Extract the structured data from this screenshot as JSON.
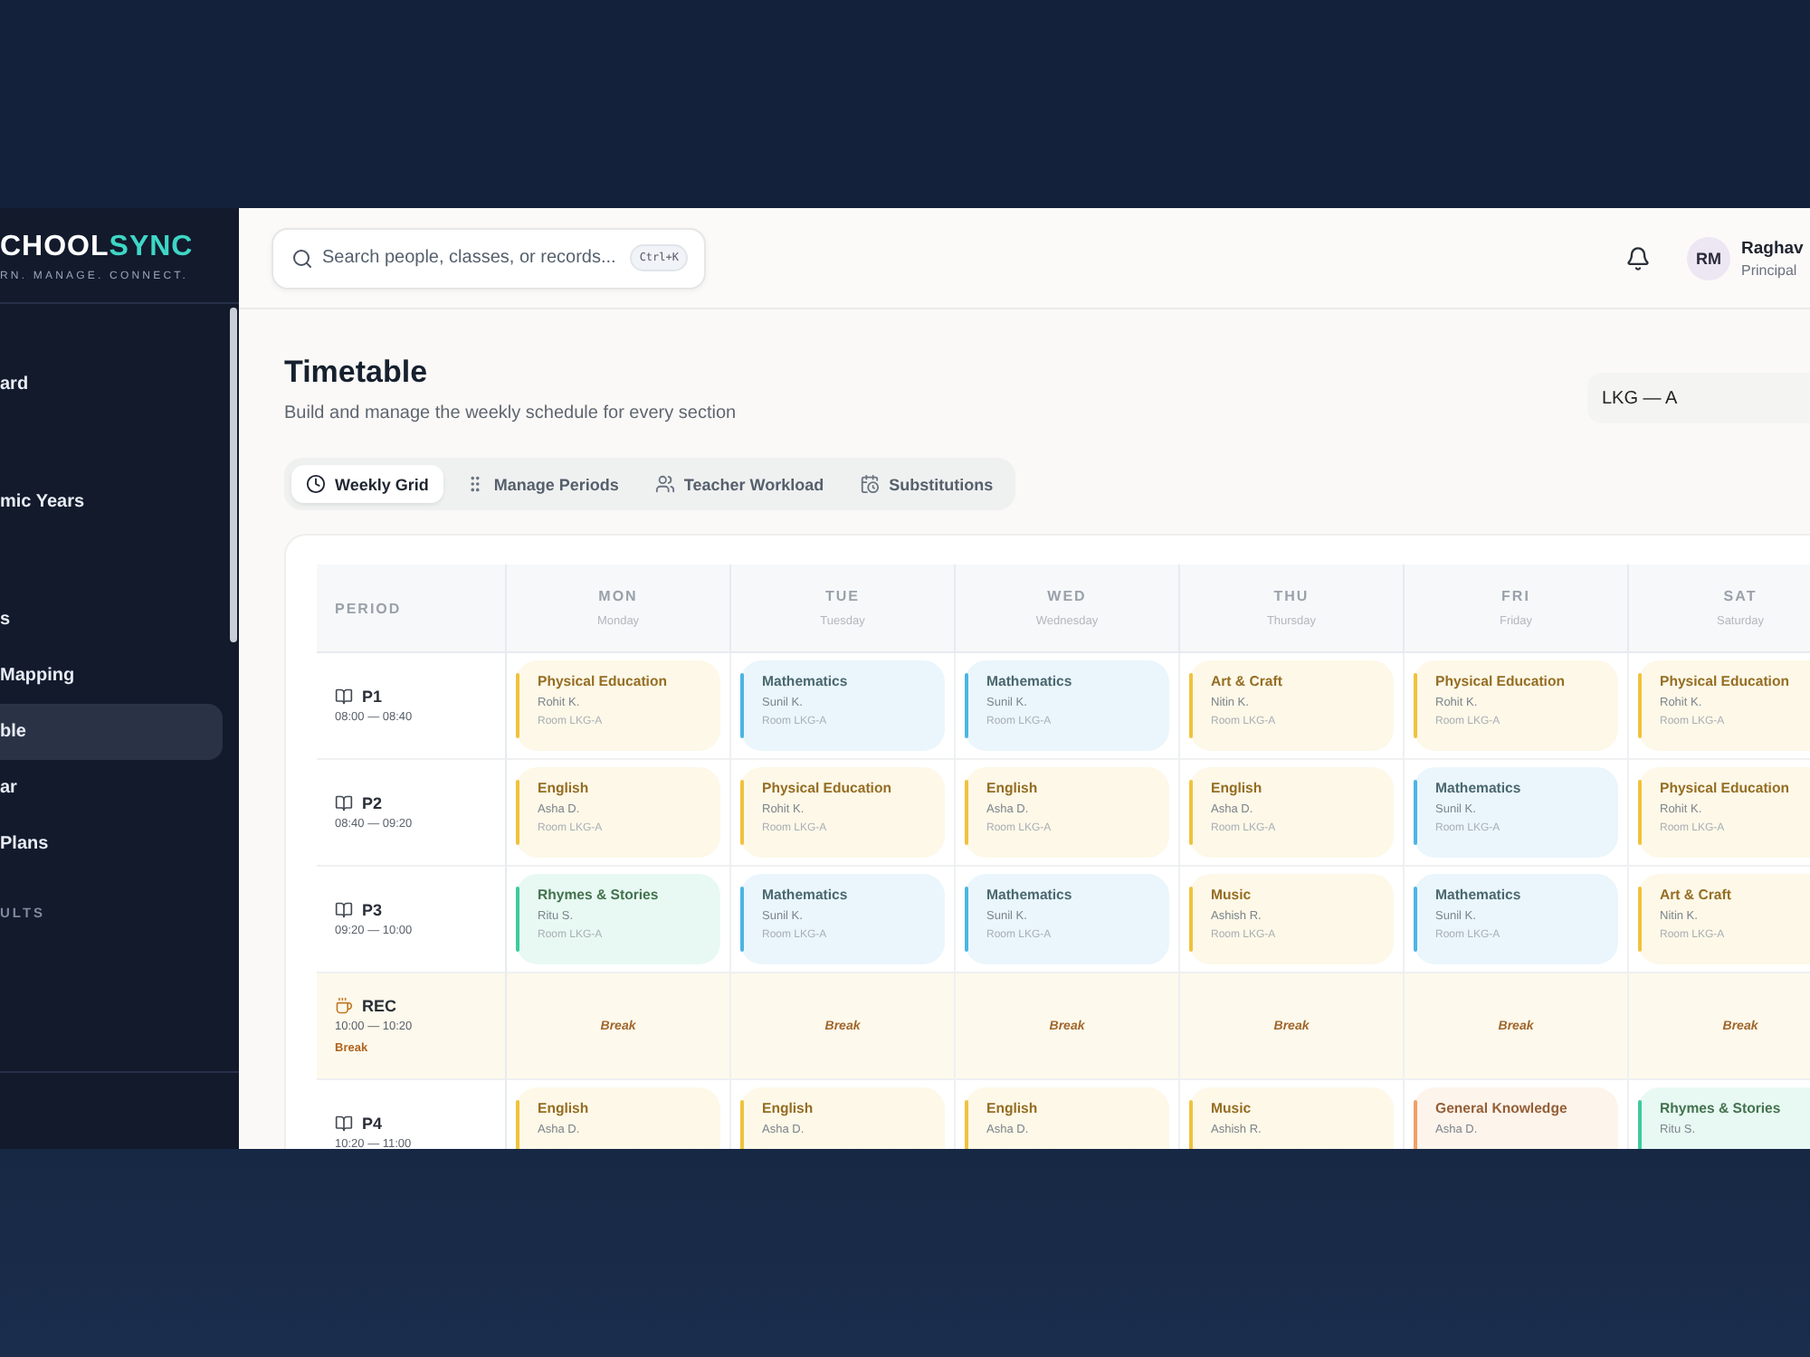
{
  "brand": {
    "name_a": "CHOOL",
    "name_b": "SYNC",
    "tagline": "RN. MANAGE. CONNECT."
  },
  "sidebar": {
    "items": [
      {
        "label": "ard",
        "selected": false
      },
      {
        "label": "mic Years",
        "selected": false
      },
      {
        "label": "s",
        "selected": false
      },
      {
        "label": "Mapping",
        "selected": false
      },
      {
        "label": "ble",
        "selected": true
      },
      {
        "label": "ar",
        "selected": false
      },
      {
        "label": "Plans",
        "selected": false
      }
    ],
    "section": "ULTS"
  },
  "search": {
    "placeholder": "Search people, classes, or records...",
    "shortcut": "Ctrl+K"
  },
  "user": {
    "initials": "RM",
    "name": "Raghav",
    "role": "Principal"
  },
  "page": {
    "title": "Timetable",
    "subtitle": "Build and manage the weekly schedule for every section",
    "section_select": "LKG — A"
  },
  "tabs": [
    {
      "label": "Weekly Grid",
      "selected": true
    },
    {
      "label": "Manage Periods",
      "selected": false
    },
    {
      "label": "Teacher Workload",
      "selected": false
    },
    {
      "label": "Substitutions",
      "selected": false
    }
  ],
  "table": {
    "period_heading": "PERIOD",
    "days": [
      {
        "short": "MON",
        "long": "Monday"
      },
      {
        "short": "TUE",
        "long": "Tuesday"
      },
      {
        "short": "WED",
        "long": "Wednesday"
      },
      {
        "short": "THU",
        "long": "Thursday"
      },
      {
        "short": "FRI",
        "long": "Friday"
      },
      {
        "short": "SAT",
        "long": "Saturday"
      }
    ],
    "rows": [
      {
        "kind": "class",
        "period": "P1",
        "time": "08:00 — 08:40",
        "cells": [
          {
            "subject": "Physical Education",
            "teacher": "Rohit K.",
            "room": "Room LKG-A",
            "color": "#f0c23c"
          },
          {
            "subject": "Mathematics",
            "teacher": "Sunil K.",
            "room": "Room LKG-A",
            "color": "#4cb4e4"
          },
          {
            "subject": "Mathematics",
            "teacher": "Sunil K.",
            "room": "Room LKG-A",
            "color": "#4cb4e4"
          },
          {
            "subject": "Art & Craft",
            "teacher": "Nitin K.",
            "room": "Room LKG-A",
            "color": "#f0c23c"
          },
          {
            "subject": "Physical Education",
            "teacher": "Rohit K.",
            "room": "Room LKG-A",
            "color": "#f0c23c"
          },
          {
            "subject": "Physical Education",
            "teacher": "Rohit K.",
            "room": "Room LKG-A",
            "color": "#f0c23c"
          }
        ]
      },
      {
        "kind": "class",
        "period": "P2",
        "time": "08:40 — 09:20",
        "cells": [
          {
            "subject": "English",
            "teacher": "Asha D.",
            "room": "Room LKG-A",
            "color": "#f0c23c"
          },
          {
            "subject": "Physical Education",
            "teacher": "Rohit K.",
            "room": "Room LKG-A",
            "color": "#f0c23c"
          },
          {
            "subject": "English",
            "teacher": "Asha D.",
            "room": "Room LKG-A",
            "color": "#f0c23c"
          },
          {
            "subject": "English",
            "teacher": "Asha D.",
            "room": "Room LKG-A",
            "color": "#f0c23c"
          },
          {
            "subject": "Mathematics",
            "teacher": "Sunil K.",
            "room": "Room LKG-A",
            "color": "#4cb4e4"
          },
          {
            "subject": "Physical Education",
            "teacher": "Rohit K.",
            "room": "Room LKG-A",
            "color": "#f0c23c"
          }
        ]
      },
      {
        "kind": "class",
        "period": "P3",
        "time": "09:20 — 10:00",
        "cells": [
          {
            "subject": "Rhymes & Stories",
            "teacher": "Ritu S.",
            "room": "Room LKG-A",
            "color": "#3ccc9c"
          },
          {
            "subject": "Mathematics",
            "teacher": "Sunil K.",
            "room": "Room LKG-A",
            "color": "#4cb4e4"
          },
          {
            "subject": "Mathematics",
            "teacher": "Sunil K.",
            "room": "Room LKG-A",
            "color": "#4cb4e4"
          },
          {
            "subject": "Music",
            "teacher": "Ashish R.",
            "room": "Room LKG-A",
            "color": "#f0c23c"
          },
          {
            "subject": "Mathematics",
            "teacher": "Sunil K.",
            "room": "Room LKG-A",
            "color": "#4cb4e4"
          },
          {
            "subject": "Art & Craft",
            "teacher": "Nitin K.",
            "room": "Room LKG-A",
            "color": "#f0c23c"
          }
        ]
      },
      {
        "kind": "break",
        "period": "REC",
        "time": "10:00 — 10:20",
        "tag": "Break",
        "cells": [
          {
            "label": "Break"
          },
          {
            "label": "Break"
          },
          {
            "label": "Break"
          },
          {
            "label": "Break"
          },
          {
            "label": "Break"
          },
          {
            "label": "Break"
          }
        ]
      },
      {
        "kind": "class",
        "period": "P4",
        "time": "10:20 — 11:00",
        "cells": [
          {
            "subject": "English",
            "teacher": "Asha D.",
            "color": "#f0c23c"
          },
          {
            "subject": "English",
            "teacher": "Asha D.",
            "color": "#f0c23c"
          },
          {
            "subject": "English",
            "teacher": "Asha D.",
            "color": "#f0c23c"
          },
          {
            "subject": "Music",
            "teacher": "Ashish R.",
            "color": "#f0c23c"
          },
          {
            "subject": "General Knowledge",
            "teacher": "Asha D.",
            "color": "#f0a064"
          },
          {
            "subject": "Rhymes & Stories",
            "teacher": "Ritu S.",
            "color": "#3ccc9c"
          }
        ]
      }
    ]
  }
}
